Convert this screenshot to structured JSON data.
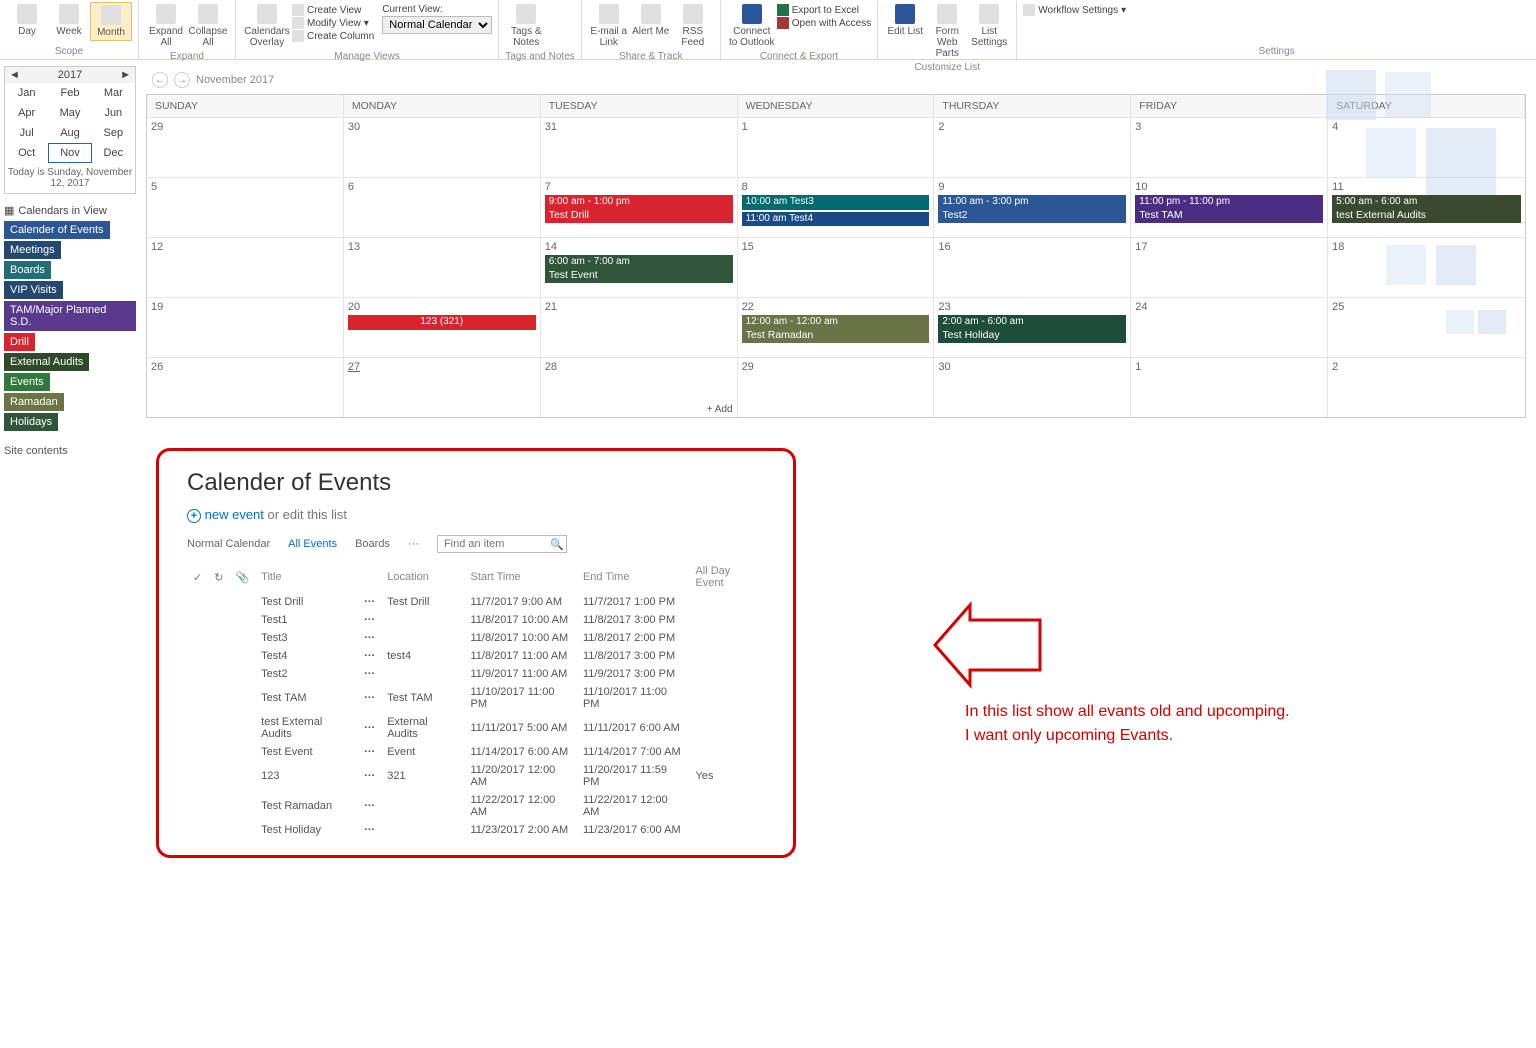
{
  "ribbon": {
    "scope": {
      "label": "Scope",
      "day": "Day",
      "week": "Week",
      "month": "Month"
    },
    "expand": {
      "label": "Expand",
      "expand_all": "Expand All",
      "collapse_all": "Collapse All"
    },
    "manage": {
      "label": "Manage Views",
      "overlay": "Calendars Overlay",
      "create_view": "Create View",
      "modify_view": "Modify View",
      "create_column": "Create Column",
      "current_view_lbl": "Current View:",
      "current_view": "Normal Calendar"
    },
    "tags": {
      "label": "Tags and Notes",
      "tags_notes": "Tags & Notes"
    },
    "share": {
      "label": "Share & Track",
      "email": "E-mail a Link",
      "alert": "Alert Me",
      "rss": "RSS Feed"
    },
    "connect": {
      "label": "Connect & Export",
      "outlook": "Connect to Outlook",
      "excel": "Export to Excel",
      "access": "Open with Access"
    },
    "customize": {
      "label": "Customize List",
      "edit": "Edit List",
      "form": "Form Web Parts",
      "list": "List Settings"
    },
    "settings": {
      "label": "Settings",
      "workflow": "Workflow Settings"
    }
  },
  "mini": {
    "year": "2017",
    "months": [
      "Jan",
      "Feb",
      "Mar",
      "Apr",
      "May",
      "Jun",
      "Jul",
      "Aug",
      "Sep",
      "Oct",
      "Nov",
      "Dec"
    ],
    "selected": "Nov",
    "today": "Today is Sunday, November 12, 2017"
  },
  "civ": {
    "heading": "Calendars in View",
    "items": [
      {
        "label": "Calender of Events",
        "cls": "t-blue"
      },
      {
        "label": "Meetings",
        "cls": "t-navy"
      },
      {
        "label": "Boards",
        "cls": "t-teal"
      },
      {
        "label": "VIP Visits",
        "cls": "t-navy"
      },
      {
        "label": "TAM/Major Planned S.D.",
        "cls": "t-purple"
      },
      {
        "label": "Drill",
        "cls": "t-red"
      },
      {
        "label": "External Audits",
        "cls": "t-dgrn"
      },
      {
        "label": "Events",
        "cls": "t-grn"
      },
      {
        "label": "Ramadan",
        "cls": "t-olive"
      },
      {
        "label": "Holidays",
        "cls": "t-pine"
      }
    ]
  },
  "sitecontents": "Site contents",
  "cal": {
    "title": "November 2017",
    "dows": [
      "SUNDAY",
      "MONDAY",
      "TUESDAY",
      "WEDNESDAY",
      "THURSDAY",
      "FRIDAY",
      "SATURDAY"
    ],
    "weeks": [
      [
        {
          "n": "29"
        },
        {
          "n": "30"
        },
        {
          "n": "31"
        },
        {
          "n": "1"
        },
        {
          "n": "2"
        },
        {
          "n": "3"
        },
        {
          "n": "4"
        }
      ],
      [
        {
          "n": "5"
        },
        {
          "n": "6"
        },
        {
          "n": "7",
          "ev": [
            {
              "t": "9:00 am - 1:00 pm",
              "s": "Test Drill",
              "c": "c-red"
            }
          ]
        },
        {
          "n": "8",
          "ev": [
            {
              "t": "10:00 am Test3",
              "c": "c-teal"
            },
            {
              "t": "11:00 am Test4",
              "c": "c-navy"
            }
          ]
        },
        {
          "n": "9",
          "ev": [
            {
              "t": "11:00 am - 3:00 pm",
              "s": "Test2",
              "c": "c-blue"
            }
          ]
        },
        {
          "n": "10",
          "ev": [
            {
              "t": "11:00 pm - 11:00 pm",
              "s": "Test TAM",
              "c": "c-purple"
            }
          ]
        },
        {
          "n": "11",
          "ev": [
            {
              "t": "5:00 am - 6:00 am",
              "s": "test External Audits",
              "c": "c-dgreen"
            }
          ]
        }
      ],
      [
        {
          "n": "12"
        },
        {
          "n": "13"
        },
        {
          "n": "14",
          "ev": [
            {
              "t": "6:00 am - 7:00 am",
              "s": "Test Event",
              "c": "c-dgrn2"
            }
          ]
        },
        {
          "n": "15"
        },
        {
          "n": "16"
        },
        {
          "n": "17"
        },
        {
          "n": "18"
        }
      ],
      [
        {
          "n": "19"
        },
        {
          "n": "20",
          "ev": [
            {
              "t": "123 (321)",
              "c": "c-red",
              "center": true
            }
          ]
        },
        {
          "n": "21"
        },
        {
          "n": "22",
          "ev": [
            {
              "t": "12:00 am - 12:00 am",
              "s": "Test Ramadan",
              "c": "c-olive"
            }
          ]
        },
        {
          "n": "23",
          "ev": [
            {
              "t": "2:00 am - 6:00 am",
              "s": "Test Holiday",
              "c": "c-pine"
            }
          ]
        },
        {
          "n": "24"
        },
        {
          "n": "25"
        }
      ],
      [
        {
          "n": "26"
        },
        {
          "n": "27",
          "u": true
        },
        {
          "n": "28",
          "add": true
        },
        {
          "n": "29"
        },
        {
          "n": "30"
        },
        {
          "n": "1"
        },
        {
          "n": "2"
        }
      ]
    ],
    "add": "Add"
  },
  "list": {
    "title": "Calender of Events",
    "new_event": "new event",
    "edit_suffix": "or edit this list",
    "views": {
      "normal": "Normal Calendar",
      "all": "All Events",
      "boards": "Boards",
      "more": "···"
    },
    "search_ph": "Find an item",
    "cols": {
      "title": "Title",
      "location": "Location",
      "start": "Start Time",
      "end": "End Time",
      "allday": "All Day Event"
    },
    "rows": [
      {
        "title": "Test Drill",
        "loc": "Test Drill",
        "start": "11/7/2017 9:00 AM",
        "end": "11/7/2017 1:00 PM",
        "ad": ""
      },
      {
        "title": "Test1",
        "loc": "",
        "start": "11/8/2017 10:00 AM",
        "end": "11/8/2017 3:00 PM",
        "ad": ""
      },
      {
        "title": "Test3",
        "loc": "",
        "start": "11/8/2017 10:00 AM",
        "end": "11/8/2017 2:00 PM",
        "ad": ""
      },
      {
        "title": "Test4",
        "loc": "test4",
        "start": "11/8/2017 11:00 AM",
        "end": "11/8/2017 3:00 PM",
        "ad": ""
      },
      {
        "title": "Test2",
        "loc": "",
        "start": "11/9/2017 11:00 AM",
        "end": "11/9/2017 3:00 PM",
        "ad": ""
      },
      {
        "title": "Test TAM",
        "loc": "Test TAM",
        "start": "11/10/2017 11:00 PM",
        "end": "11/10/2017 11:00 PM",
        "ad": ""
      },
      {
        "title": "test External Audits",
        "loc": "External Audits",
        "start": "11/11/2017 5:00 AM",
        "end": "11/11/2017 6:00 AM",
        "ad": ""
      },
      {
        "title": "Test Event",
        "loc": "Event",
        "start": "11/14/2017 6:00 AM",
        "end": "11/14/2017 7:00 AM",
        "ad": ""
      },
      {
        "title": "123",
        "loc": "321",
        "start": "11/20/2017 12:00 AM",
        "end": "11/20/2017 11:59 PM",
        "ad": "Yes"
      },
      {
        "title": "Test Ramadan",
        "loc": "",
        "start": "11/22/2017 12:00 AM",
        "end": "11/22/2017 12:00 AM",
        "ad": ""
      },
      {
        "title": "Test Holiday",
        "loc": "",
        "start": "11/23/2017 2:00 AM",
        "end": "11/23/2017 6:00 AM",
        "ad": ""
      }
    ]
  },
  "annot": {
    "line1": "In this list show all evants old and upcomping.",
    "line2": " I want only upcoming Evants."
  }
}
